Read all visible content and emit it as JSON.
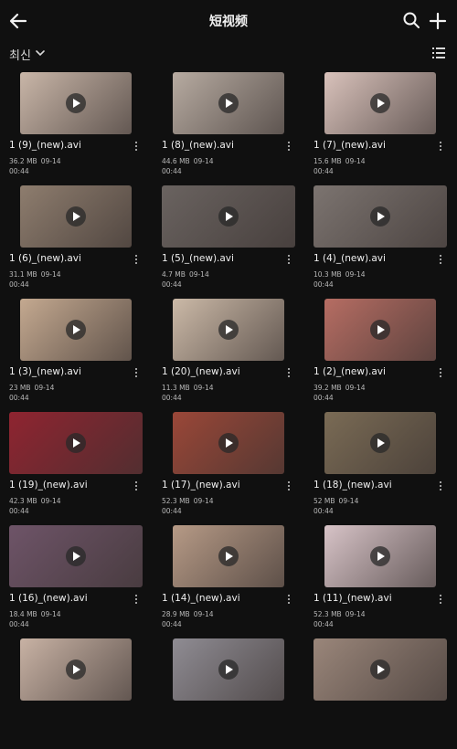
{
  "header": {
    "title": "短视频",
    "back_icon": "arrow-left-icon",
    "search_icon": "search-icon",
    "add_icon": "plus-icon"
  },
  "sort": {
    "label": "최신",
    "view_icon": "list-view-icon"
  },
  "videos": [
    {
      "name": "1 (9)_(new).avi",
      "size": "36.2 MB",
      "date": "09-14",
      "duration": "00:44",
      "color": "#c9b6a8",
      "wide": false
    },
    {
      "name": "1 (8)_(new).avi",
      "size": "44.6 MB",
      "date": "09-14",
      "duration": "00:44",
      "color": "#b7aba1",
      "wide": false
    },
    {
      "name": "1 (7)_(new).avi",
      "size": "15.6 MB",
      "date": "09-14",
      "duration": "00:44",
      "color": "#d9c2bb",
      "wide": false
    },
    {
      "name": "1 (6)_(new).avi",
      "size": "31.1 MB",
      "date": "09-14",
      "duration": "00:44",
      "color": "#8e7d6e",
      "wide": false
    },
    {
      "name": "1 (5)_(new).avi",
      "size": "4.7 MB",
      "date": "09-14",
      "duration": "00:44",
      "color": "#6a6360",
      "wide": true
    },
    {
      "name": "1 (4)_(new).avi",
      "size": "10.3 MB",
      "date": "09-14",
      "duration": "00:44",
      "color": "#7c7470",
      "wide": true
    },
    {
      "name": "1 (3)_(new).avi",
      "size": "23 MB",
      "date": "09-14",
      "duration": "00:44",
      "color": "#c4a990",
      "wide": false
    },
    {
      "name": "1 (20)_(new).avi",
      "size": "11.3 MB",
      "date": "09-14",
      "duration": "00:44",
      "color": "#cbb9a7",
      "wide": false
    },
    {
      "name": "1 (2)_(new).avi",
      "size": "39.2 MB",
      "date": "09-14",
      "duration": "00:44",
      "color": "#b66d63",
      "wide": false
    },
    {
      "name": "1 (19)_(new).avi",
      "size": "42.3 MB",
      "date": "09-14",
      "duration": "00:44",
      "color": "#8f2430",
      "wide": true
    },
    {
      "name": "1 (17)_(new).avi",
      "size": "52.3 MB",
      "date": "09-14",
      "duration": "00:44",
      "color": "#9a4738",
      "wide": false
    },
    {
      "name": "1 (18)_(new).avi",
      "size": "52 MB",
      "date": "09-14",
      "duration": "00:44",
      "color": "#7a6b55",
      "wide": false
    },
    {
      "name": "1 (16)_(new).avi",
      "size": "18.4 MB",
      "date": "09-14",
      "duration": "00:44",
      "color": "#6e5468",
      "wide": true
    },
    {
      "name": "1 (14)_(new).avi",
      "size": "28.9 MB",
      "date": "09-14",
      "duration": "00:44",
      "color": "#b69a86",
      "wide": false
    },
    {
      "name": "1 (11)_(new).avi",
      "size": "52.3 MB",
      "date": "09-14",
      "duration": "00:44",
      "color": "#d7c3c7",
      "wide": false
    },
    {
      "name": "",
      "size": "",
      "date": "",
      "duration": "",
      "color": "#c8b2a4",
      "wide": false
    },
    {
      "name": "",
      "size": "",
      "date": "",
      "duration": "",
      "color": "#8f8c93",
      "wide": false
    },
    {
      "name": "",
      "size": "",
      "date": "",
      "duration": "",
      "color": "#9a867a",
      "wide": true
    }
  ]
}
